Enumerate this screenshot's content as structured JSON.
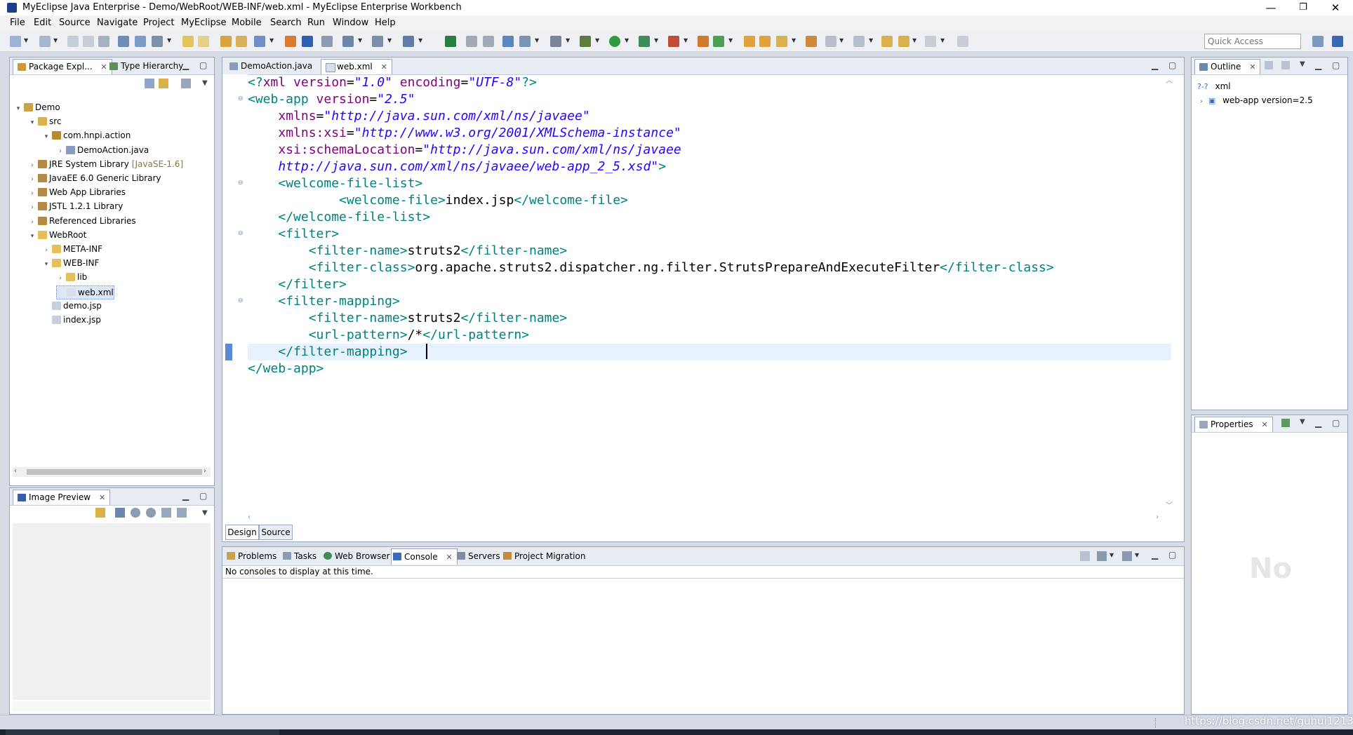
{
  "window": {
    "title": "MyEclipse Java Enterprise - Demo/WebRoot/WEB-INF/web.xml - MyEclipse Enterprise Workbench",
    "minimize": "—",
    "restore": "❐",
    "close": "✕"
  },
  "menu": [
    "File",
    "Edit",
    "Source",
    "Navigate",
    "Project",
    "MyEclipse",
    "Mobile",
    "Search",
    "Run",
    "Window",
    "Help"
  ],
  "toolbar": {
    "quick_access_placeholder": "Quick Access"
  },
  "package_explorer": {
    "tabs": [
      "Package Expl...",
      "Type Hierarchy"
    ],
    "tree": [
      {
        "label": "Demo",
        "depth": 0,
        "twisty": "▾",
        "icon": "project-icon"
      },
      {
        "label": "src",
        "depth": 1,
        "twisty": "▾",
        "icon": "source-folder-icon"
      },
      {
        "label": "com.hnpi.action",
        "depth": 2,
        "twisty": "▾",
        "icon": "package-icon"
      },
      {
        "label": "DemoAction.java",
        "depth": 3,
        "twisty": "›",
        "icon": "java-file-icon"
      },
      {
        "label": "JRE System Library",
        "suffix": "[JavaSE-1.6]",
        "depth": 1,
        "twisty": "›",
        "icon": "library-icon"
      },
      {
        "label": "JavaEE 6.0 Generic Library",
        "depth": 1,
        "twisty": "›",
        "icon": "library-icon"
      },
      {
        "label": "Web App Libraries",
        "depth": 1,
        "twisty": "›",
        "icon": "library-icon"
      },
      {
        "label": "JSTL 1.2.1 Library",
        "depth": 1,
        "twisty": "›",
        "icon": "library-icon"
      },
      {
        "label": "Referenced Libraries",
        "depth": 1,
        "twisty": "›",
        "icon": "library-icon"
      },
      {
        "label": "WebRoot",
        "depth": 1,
        "twisty": "▾",
        "icon": "folder-icon"
      },
      {
        "label": "META-INF",
        "depth": 2,
        "twisty": "›",
        "icon": "folder-icon"
      },
      {
        "label": "WEB-INF",
        "depth": 2,
        "twisty": "▾",
        "icon": "folder-icon"
      },
      {
        "label": "lib",
        "depth": 3,
        "twisty": "›",
        "icon": "folder-icon"
      },
      {
        "label": "web.xml",
        "depth": 3,
        "twisty": "",
        "icon": "xml-file-icon",
        "selected": true
      },
      {
        "label": "demo.jsp",
        "depth": 2,
        "twisty": "",
        "icon": "jsp-file-icon"
      },
      {
        "label": "index.jsp",
        "depth": 2,
        "twisty": "",
        "icon": "jsp-file-icon"
      }
    ]
  },
  "image_preview": {
    "tab": "Image Preview"
  },
  "editor": {
    "tabs": [
      "DemoAction.java",
      "web.xml"
    ],
    "bottom_tabs": [
      "Design",
      "Source"
    ],
    "lines": [
      [
        [
          "tagc",
          "<?"
        ],
        [
          "attrc",
          "xml "
        ],
        [
          "attrc",
          "version"
        ],
        [
          "txtc",
          "="
        ],
        [
          "strc",
          "\"1.0\""
        ],
        [
          "txtc",
          " "
        ],
        [
          "attrc",
          "encoding"
        ],
        [
          "txtc",
          "="
        ],
        [
          "strc",
          "\"UTF-8\""
        ],
        [
          "tagc",
          "?>"
        ]
      ],
      [
        [
          "tagc",
          "<web-app "
        ],
        [
          "attrc",
          "version"
        ],
        [
          "txtc",
          "="
        ],
        [
          "strc",
          "\"2.5\""
        ]
      ],
      [
        [
          "txtc",
          "    "
        ],
        [
          "attrc",
          "xmlns"
        ],
        [
          "txtc",
          "="
        ],
        [
          "strc",
          "\"http://java.sun.com/xml/ns/javaee\""
        ]
      ],
      [
        [
          "txtc",
          "    "
        ],
        [
          "attrc",
          "xmlns:xsi"
        ],
        [
          "txtc",
          "="
        ],
        [
          "strc",
          "\"http://www.w3.org/2001/XMLSchema-instance\""
        ]
      ],
      [
        [
          "txtc",
          "    "
        ],
        [
          "attrc",
          "xsi:schemaLocation"
        ],
        [
          "txtc",
          "="
        ],
        [
          "strc",
          "\"http://java.sun.com/xml/ns/javaee"
        ]
      ],
      [
        [
          "txtc",
          "    "
        ],
        [
          "strc",
          "http://java.sun.com/xml/ns/javaee/web-app_2_5.xsd\""
        ],
        [
          "tagc",
          ">"
        ]
      ],
      [
        [
          "txtc",
          "    "
        ],
        [
          "tagc",
          "<welcome-file-list>"
        ]
      ],
      [
        [
          "txtc",
          "            "
        ],
        [
          "tagc",
          "<welcome-file>"
        ],
        [
          "txtc",
          "index.jsp"
        ],
        [
          "tagc",
          "</welcome-file>"
        ]
      ],
      [
        [
          "txtc",
          "    "
        ],
        [
          "tagc",
          "</welcome-file-list>"
        ]
      ],
      [
        [
          "txtc",
          "    "
        ],
        [
          "tagc",
          "<filter>"
        ]
      ],
      [
        [
          "txtc",
          "        "
        ],
        [
          "tagc",
          "<filter-name>"
        ],
        [
          "txtc",
          "struts2"
        ],
        [
          "tagc",
          "</filter-name>"
        ]
      ],
      [
        [
          "txtc",
          "        "
        ],
        [
          "tagc",
          "<filter-class>"
        ],
        [
          "txtc",
          "org.apache.struts2.dispatcher.ng.filter.StrutsPrepareAndExecuteFilter"
        ],
        [
          "tagc",
          "</filter-class>"
        ]
      ],
      [
        [
          "txtc",
          "    "
        ],
        [
          "tagc",
          "</filter>"
        ]
      ],
      [
        [
          "txtc",
          "    "
        ],
        [
          "tagc",
          "<filter-mapping>"
        ]
      ],
      [
        [
          "txtc",
          "        "
        ],
        [
          "tagc",
          "<filter-name>"
        ],
        [
          "txtc",
          "struts2"
        ],
        [
          "tagc",
          "</filter-name>"
        ]
      ],
      [
        [
          "txtc",
          "        "
        ],
        [
          "tagc",
          "<url-pattern>"
        ],
        [
          "txtc",
          "/*"
        ],
        [
          "tagc",
          "</url-pattern>"
        ]
      ],
      [
        [
          "txtc",
          "    "
        ],
        [
          "tagc",
          "</filter-mapping>"
        ]
      ],
      [
        [
          "tagc",
          "</web-app>"
        ]
      ]
    ],
    "fold_lines": [
      2,
      7,
      10,
      14
    ],
    "current_line": 17
  },
  "bottom_panel": {
    "tabs": [
      "Problems",
      "Tasks",
      "Web Browser",
      "Console",
      "Servers",
      "Project Migration"
    ],
    "active_tab": "Console",
    "message": "No consoles to display at this time."
  },
  "outline": {
    "tab": "Outline",
    "items": [
      {
        "label": "xml",
        "prefix": "?-?"
      },
      {
        "label": "web-app version=2.5",
        "prefix": "▣"
      }
    ]
  },
  "properties": {
    "tab": "Properties",
    "empty_hint": "No"
  },
  "watermark": "https://blog.csdn.net/guhui12138",
  "colors": {
    "tag": "#008080",
    "attribute": "#7f007f",
    "string": "#2a00ff",
    "view_border": "#98a6bf",
    "workspace_bg": "#d6dbe6"
  }
}
